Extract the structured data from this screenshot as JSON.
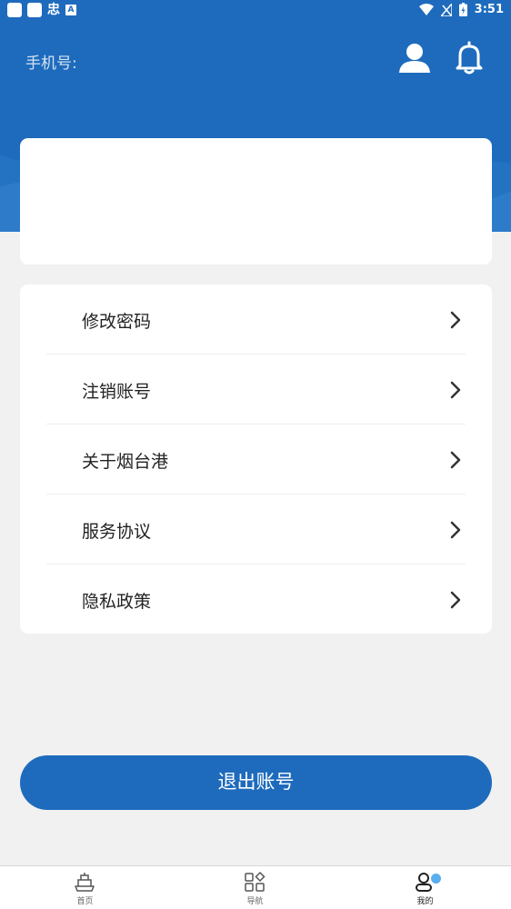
{
  "status_bar": {
    "time": "3:51",
    "left_glyph": "忠",
    "left_badge": "A"
  },
  "header": {
    "phone_label": "手机号:",
    "icons": [
      "user-icon",
      "bell-icon"
    ]
  },
  "menu": {
    "items": [
      {
        "label": "修改密码"
      },
      {
        "label": "注销账号"
      },
      {
        "label": "关于烟台港"
      },
      {
        "label": "服务协议"
      },
      {
        "label": "隐私政策"
      }
    ]
  },
  "logout": {
    "label": "退出账号"
  },
  "tabbar": {
    "tabs": [
      {
        "label": "首页",
        "icon": "ship-icon"
      },
      {
        "label": "导航",
        "icon": "grid-icon"
      },
      {
        "label": "我的",
        "icon": "profile-icon"
      }
    ],
    "active_index": 2
  },
  "colors": {
    "primary": "#1e6bbd",
    "background": "#f1f1f1",
    "badge": "#5aaef0"
  }
}
